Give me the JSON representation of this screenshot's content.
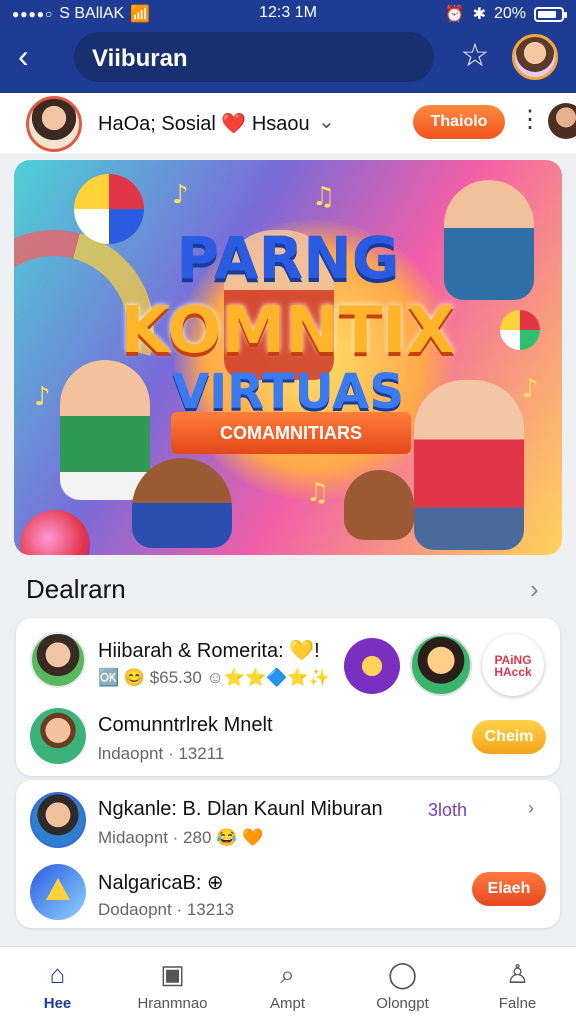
{
  "status_bar": {
    "carrier": "S BAllAK",
    "time": "12:3 1M",
    "battery": "20%"
  },
  "header": {
    "back_label": "‹",
    "title": "Viiburan"
  },
  "profile": {
    "name": "HaOa; Sosial ❤️ Hsaou",
    "action": "Thaiolo"
  },
  "banner": {
    "line1": "PARNG",
    "line2": "KOMNTIX",
    "line3": "VIRTUAS",
    "ribbon": "COMAMNITIARS"
  },
  "section": {
    "title": "Dealrarn"
  },
  "card1": {
    "row1": {
      "title": "Hiibarah & Romerita: 💛!",
      "sub": "🆗 😊 $65.30 ☺⭐⭐🔷⭐✨"
    },
    "row2": {
      "title": "Comunntrlrek Mnelt",
      "sub": "lndaopnt · 13211",
      "action": "Cheim"
    },
    "sticker_text": "PAiNG HAcck"
  },
  "card2": {
    "row1": {
      "title": "Ngkanle: B. Dlan Kaunl Miburan",
      "sub": "Midaopnt · 280 😂 🧡",
      "link": "3loth"
    },
    "row2": {
      "title": "NalgaricaB: ⊕",
      "sub": "Dodaopnt · 13213",
      "action": "Elaeh"
    }
  },
  "nav": {
    "items": [
      {
        "label": "Hee",
        "icon": "home-icon"
      },
      {
        "label": "Hranmnao",
        "icon": "frame-icon"
      },
      {
        "label": "Ampt",
        "icon": "search-icon"
      },
      {
        "label": "Olongpt",
        "icon": "chat-icon"
      },
      {
        "label": "Falne",
        "icon": "profile-icon"
      }
    ]
  },
  "colors": {
    "header_bg": "#1f3c94",
    "accent_orange": "#f2541f",
    "accent_yellow": "#f3a51a"
  }
}
